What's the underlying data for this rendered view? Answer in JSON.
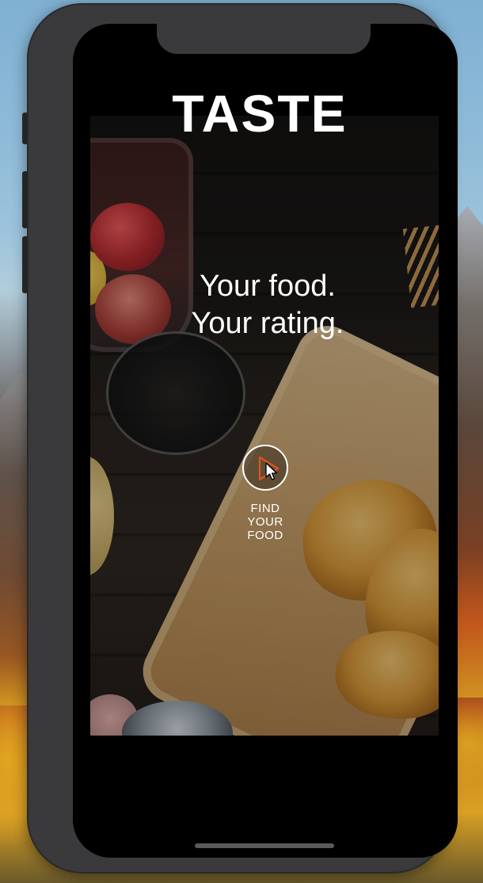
{
  "app": {
    "title": "TASTE",
    "tagline_line1": "Your food.",
    "tagline_line2": "Your rating."
  },
  "cta": {
    "label_line1": "FIND",
    "label_line2": "YOUR",
    "label_line3": "FOOD",
    "icon": "play-icon",
    "accent_color": "#e0531a"
  },
  "background_image": {
    "subject": "food-photo"
  }
}
